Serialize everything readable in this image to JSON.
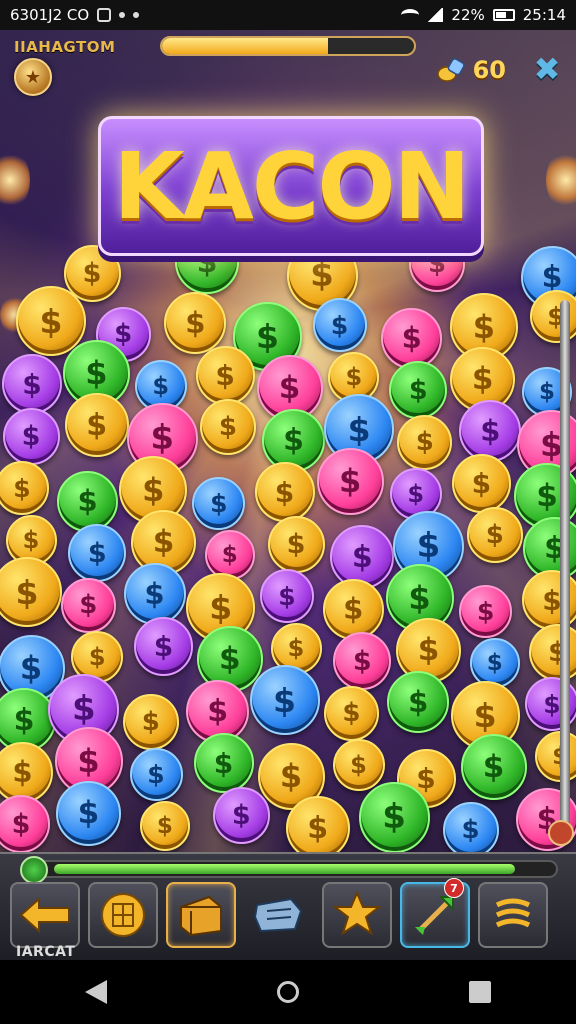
{
  "status_bar": {
    "left_text": "6301J2 CO",
    "battery": "22%",
    "time": "25:14"
  },
  "top": {
    "game_name": "IIAHAGTOM",
    "level_progress": 0.66,
    "coins": "60"
  },
  "title": "KACON",
  "bottom": {
    "energy_progress": 0.93,
    "label": "IARCAT",
    "tools": [
      {
        "name": "coin-stack-tool",
        "selected": false
      },
      {
        "name": "gold-chest-tool",
        "selected": true
      },
      {
        "name": "blue-token-tool",
        "selected": false
      },
      {
        "name": "gold-star-tool",
        "selected": false
      },
      {
        "name": "green-arrow-tool",
        "selected": true,
        "badge": "7"
      },
      {
        "name": "menu-tool",
        "selected": false
      }
    ]
  },
  "colors": {
    "gold": "#ffd43b",
    "green": "#3ed24a",
    "pink": "#ff4aa8",
    "blue": "#3a8dff",
    "purple": "#b044ff",
    "accent": "#e7b04a"
  }
}
